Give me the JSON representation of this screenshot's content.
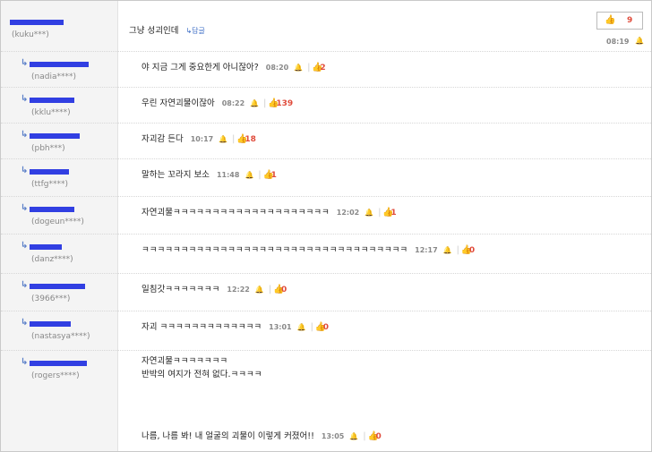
{
  "top": {
    "id": "(kuku***)",
    "text": "그냥 성괴인데",
    "reply_label": "답글",
    "likes": "9",
    "time": "08:19"
  },
  "replies": [
    {
      "id": "(nadia****)",
      "text": "야 지금 그게 중요한게 아니잖아?",
      "time": "08:20",
      "likes": "2"
    },
    {
      "id": "(kklu****)",
      "text": "우린 자연괴물이잖아",
      "time": "08:22",
      "likes": "139"
    },
    {
      "id": "(pbh***)",
      "text": "자괴감 든다",
      "time": "10:17",
      "likes": "18"
    },
    {
      "id": "(ttfg****)",
      "text": "말하는 꼬라지 보소",
      "time": "11:48",
      "likes": "1"
    },
    {
      "id": "(dogeun****)",
      "text": "자연괴물ㅋㅋㅋㅋㅋㅋㅋㅋㅋㅋㅋㅋㅋㅋㅋㅋㅋㅋㅋㅋ",
      "time": "12:02",
      "likes": "1"
    },
    {
      "id": "(danz****)",
      "text": "ㅋㅋㅋㅋㅋㅋㅋㅋㅋㅋㅋㅋㅋㅋㅋㅋㅋㅋㅋㅋㅋㅋㅋㅋㅋㅋㅋㅋㅋㅋㅋㅋㅋㅋ",
      "time": "12:17",
      "likes": "0"
    },
    {
      "id": "(3966***)",
      "text": "일침갓ㅋㅋㅋㅋㅋㅋㅋ",
      "time": "12:22",
      "likes": "0"
    },
    {
      "id": "(nastasya****)",
      "text": "자괴 ㅋㅋㅋㅋㅋㅋㅋㅋㅋㅋㅋㅋㅋ",
      "time": "13:01",
      "likes": "0"
    },
    {
      "id": "(rogers****)",
      "text_lines": [
        "자연괴물ㅋㅋㅋㅋㅋㅋㅋ",
        "반박의 여지가 전혀 없다.ㅋㅋㅋㅋ",
        "나름, 나름 봐! 내 얼굴의 괴물이 이렇게 커졌어!!"
      ],
      "time": "13:05",
      "likes": "0"
    }
  ]
}
